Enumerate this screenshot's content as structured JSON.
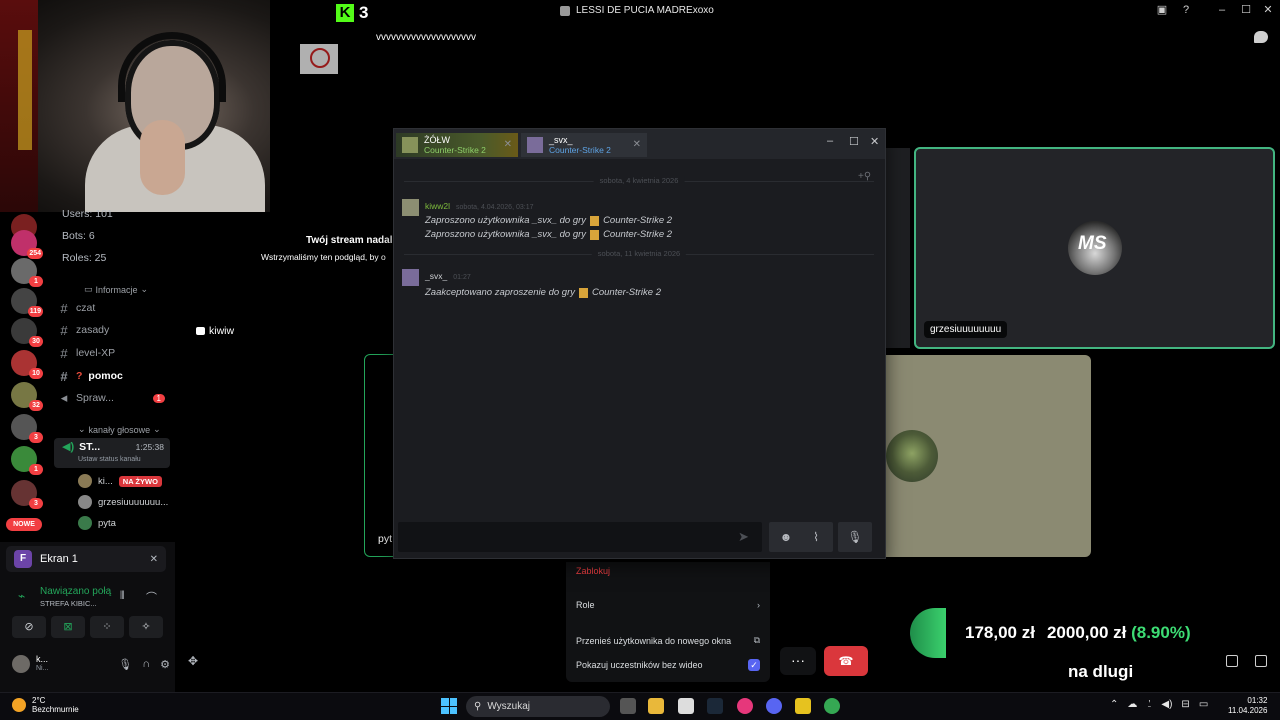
{
  "window": {
    "title": "LESSI DE PUCIA MADRExoxo"
  },
  "kick": {
    "logo": "K",
    "count": "3"
  },
  "stream_text": "vvvvvvvvvvvvvvvvvvvv",
  "server_info": {
    "users": "Users: 101",
    "bots": "Bots: 6",
    "roles": "Roles: 25"
  },
  "server_badges": [
    "254",
    "1",
    "119",
    "30",
    "10",
    "32",
    "3",
    "1",
    "3"
  ],
  "new_badge": "NOWE",
  "channels": {
    "info_category": "Informacje",
    "items": [
      {
        "name": "czat"
      },
      {
        "name": "zasady"
      },
      {
        "name": "level-XP"
      },
      {
        "name": "pomoc"
      },
      {
        "name": "Spraw...",
        "badge": "1"
      }
    ],
    "voice_category": "kanały głosowe",
    "voice_channel": {
      "name": "ST...",
      "time": "1:25:38",
      "status": "Ustaw status kanału"
    },
    "voice_users": [
      {
        "name": "ki...",
        "live": "NA ŻYWO"
      },
      {
        "name": "grzesiuuuuuuu..."
      },
      {
        "name": "pyta"
      }
    ]
  },
  "panel": {
    "screen_share": "Ekran 1",
    "screen_icon": "F",
    "connection": "Nawiązano połą",
    "connection_sub": "STREFA KIBIC...",
    "user": {
      "name": "k...",
      "sub": "Ni..."
    }
  },
  "paused": {
    "title": "Twój stream nadal",
    "subtitle": "Wstrzymaliśmy ten podgląd, by o"
  },
  "kiwiw": "kiwiw",
  "pyt": "pyt",
  "tiles": {
    "grze_name": "grzesiuuuuuuuu",
    "grze_logo": "MS"
  },
  "steam": {
    "tabs": [
      {
        "name": "ŻÓŁW",
        "game": "Counter-Strike 2"
      },
      {
        "name": "_svx_",
        "game": "Counter-Strike 2"
      }
    ],
    "day1": "sobota, 4 kwietnia 2026",
    "day2": "sobota, 11 kwietnia 2026",
    "msg1": {
      "author": "kiww2l",
      "time": "sobota, 4.04.2026, 03:17",
      "line1_text": "Zaproszono użytkownika _svx_ do gry",
      "line1_game": "Counter-Strike 2",
      "line2_text": "Zaproszono użytkownika _svx_ do gry",
      "line2_game": "Counter-Strike 2"
    },
    "msg2": {
      "author": "_svx_",
      "time": "01:27",
      "line1_text": "Zaakceptowano zaproszenie do gry",
      "line1_game": "Counter-Strike 2"
    }
  },
  "context_menu": {
    "block": "Zablokuj",
    "roles": "Role",
    "move_window": "Przenieś użytkownika do nowego okna",
    "show_no_video": "Pokazuj uczestników bez wideo"
  },
  "donation": {
    "current": "178,00 zł",
    "goal": "2000,00 zł",
    "percent": "(8.90%)",
    "caption": "na dlugi"
  },
  "taskbar": {
    "weather_temp": "2°C",
    "weather_desc": "Bezchmurnie",
    "search": "Wyszukaj",
    "time": "01:32",
    "date": "11.04.2026"
  },
  "colors": {
    "accent_green": "#23a55a",
    "danger": "#da373c",
    "discord_blurple": "#5865f2",
    "kick_green": "#53fc18"
  },
  "icons": [
    "search-icon",
    "windows-start-icon",
    "phone-hangup-icon",
    "more-icon",
    "close-icon",
    "minimize-icon",
    "maximize-icon",
    "send-icon",
    "emoji-icon",
    "attach-icon",
    "voice-icon",
    "speaker-icon",
    "mic-icon",
    "headphones-icon",
    "gear-icon"
  ]
}
